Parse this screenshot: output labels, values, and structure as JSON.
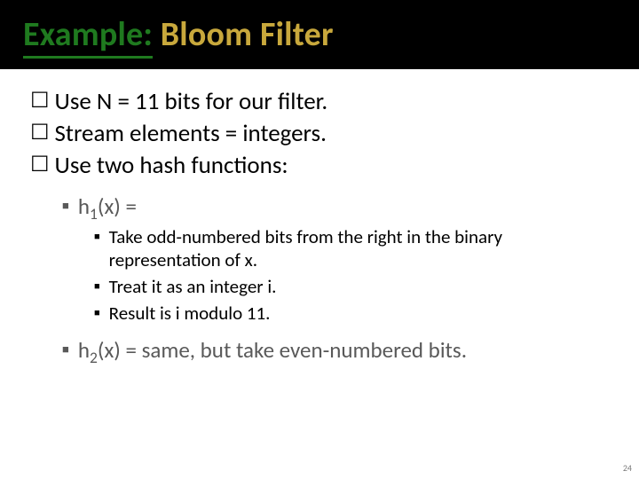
{
  "title": {
    "part1": "Example:",
    "part2": " Bloom Filter"
  },
  "bullets": {
    "a": "Use N = 11 bits for our filter.",
    "b": "Stream elements = integers.",
    "c": "Use two hash functions:"
  },
  "h1": {
    "pre": "h",
    "sub": "1",
    "post": "(x) ="
  },
  "h1_steps": {
    "a": "Take odd-numbered bits from the right in the binary representation of x.",
    "b": "Treat it as an integer i.",
    "c": "Result is i modulo 11."
  },
  "h2": {
    "pre": "h",
    "sub": "2",
    "post": "(x) = same, but take even-numbered bits."
  },
  "page_number": "24"
}
